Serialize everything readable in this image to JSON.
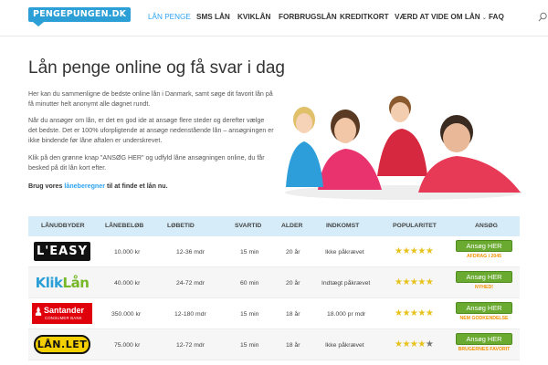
{
  "header": {
    "logo_text": "PENGEPUNGEN.DK",
    "nav": [
      {
        "label": "LÅN PENGE",
        "active": true
      },
      {
        "label": "SMS LÅN",
        "active": false
      },
      {
        "label": "KVIKLÅN",
        "active": false
      },
      {
        "label": "FORBRUGSLÅN",
        "active": false
      },
      {
        "label": "KREDITKORT",
        "active": false
      },
      {
        "label": "VÆRD AT VIDE OM LÅN",
        "active": false,
        "has_dropdown": true
      },
      {
        "label": "FAQ",
        "active": false
      }
    ],
    "search_icon": "search-icon"
  },
  "main": {
    "title": "Lån penge online og få svar i dag",
    "paragraphs": [
      "Her kan du sammenligne de bedste online lån i Danmark, samt søge dit favorit lån på få minutter helt anonymt alle døgnet rundt.",
      "Når du ansøger om lån, er det en god ide at ansøge flere steder og derefter vælge det bedste. Det er 100% uforpligtende at ansøge nedenstående lån – ansøgningen er ikke bindende før låne aftalen er underskrevet.",
      "Klik på den grønne knap \"ANSØG HER\" og udfyld låne ansøgningen online, du får besked på dit lån kort efter."
    ],
    "cta_prefix": "Brug vores ",
    "cta_link": "låneberegner",
    "cta_suffix": " til at finde et lån nu."
  },
  "table": {
    "headers": [
      "LÅNUDBYDER",
      "LÅNEBELØB",
      "LØBETID",
      "SVARTID",
      "ALDER",
      "INDKOMST",
      "POPULARITET",
      "ANSØG"
    ],
    "rows": [
      {
        "brand": "L'EASY",
        "amount": "10.000 kr",
        "term": "12-36 mdr",
        "response": "15 min",
        "age": "20 år",
        "income": "Ikke påkrævet",
        "rating": 5,
        "apply": "Ansøg HER",
        "note": "AFDRAG i 2045"
      },
      {
        "brand": "KlikLån",
        "brand_a": "Klik",
        "brand_b": "Lån",
        "amount": "40.000 kr",
        "term": "24-72 mdr",
        "response": "60 min",
        "age": "20 år",
        "income": "Indtægt påkrævet",
        "rating": 5,
        "apply": "Ansøg HER",
        "note": "NYHED!"
      },
      {
        "brand": "Santander",
        "brand_sub": "CONSUMER BANK",
        "amount": "350.000 kr",
        "term": "12-180 mdr",
        "response": "15 min",
        "age": "18 år",
        "income": "18.000 pr mdr",
        "rating": 5,
        "apply": "Ansøg HER",
        "note": "NEM GODKENDELSE"
      },
      {
        "brand": "LÅN.LET",
        "amount": "75.000 kr",
        "term": "12-72 mdr",
        "response": "15 min",
        "age": "18 år",
        "income": "Ikke påkrævet",
        "rating": 4,
        "apply": "Ansøg HER",
        "note": "BRUGERNES FAVORIT"
      }
    ]
  },
  "colors": {
    "accent": "#2ea3f2",
    "apply_button": "#6aaa30",
    "note": "#f29100",
    "star": "#e8c21c",
    "table_header": "#d6ecf8"
  }
}
